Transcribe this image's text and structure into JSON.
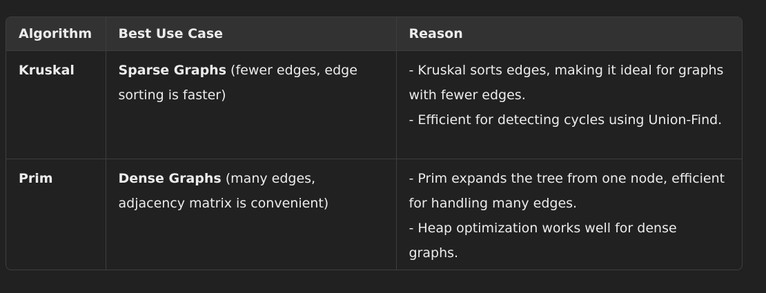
{
  "table": {
    "headers": [
      "Algorithm",
      "Best Use Case",
      "Reason"
    ],
    "rows": [
      {
        "algorithm": "Kruskal",
        "use_case_bold": "Sparse Graphs",
        "use_case_rest": " (fewer edges, edge sorting is faster)",
        "reasons": [
          "- Kruskal sorts edges, making it ideal for graphs with fewer edges.",
          "- Efficient for detecting cycles using Union-Find."
        ]
      },
      {
        "algorithm": "Prim",
        "use_case_bold": "Dense Graphs",
        "use_case_rest": " (many edges, adjacency matrix is convenient)",
        "reasons": [
          "- Prim expands the tree from one node, efficient for handling many edges.",
          "- Heap optimization works well for dense graphs."
        ]
      }
    ]
  }
}
